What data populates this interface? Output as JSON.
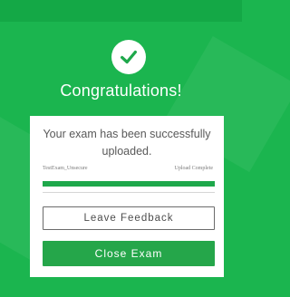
{
  "dialog": {
    "heading": "Congratulations!",
    "message": "Your exam has been successfully uploaded.",
    "exam_name": "TestExam_Unsecure",
    "upload_status": "Upload Complete",
    "upload_progress_percent": 100,
    "buttons": {
      "feedback_label": "Leave Feedback",
      "close_label": "Close Exam"
    },
    "icon": "checkmark-icon"
  },
  "colors": {
    "background": "#1bb54f",
    "accent": "#25a64a",
    "card": "#ffffff"
  }
}
